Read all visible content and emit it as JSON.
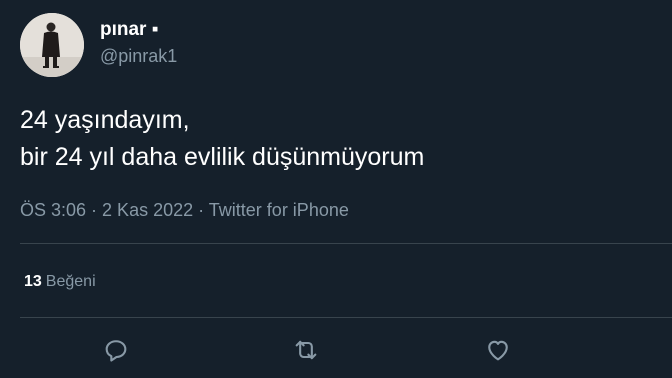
{
  "author": {
    "display_name": "pınar ▪",
    "handle": "@pinrak1",
    "avatar_icon": "avatar-photo"
  },
  "tweet": {
    "lines": [
      "24 yaşındayım,",
      "bir 24 yıl daha evlilik düşünmüyorum"
    ]
  },
  "meta": {
    "time": "ÖS 3:06",
    "separator": " · ",
    "date": "2 Kas 2022",
    "source": "Twitter for iPhone"
  },
  "stats": {
    "likes_count": "13",
    "likes_label": "Beğeni"
  },
  "actions": [
    {
      "name": "reply",
      "icon": "reply-icon"
    },
    {
      "name": "retweet",
      "icon": "retweet-icon"
    },
    {
      "name": "like",
      "icon": "heart-icon"
    }
  ],
  "colors": {
    "background": "#15202b",
    "text_primary": "#ffffff",
    "text_secondary": "#8899a6",
    "divider": "#38444d"
  }
}
